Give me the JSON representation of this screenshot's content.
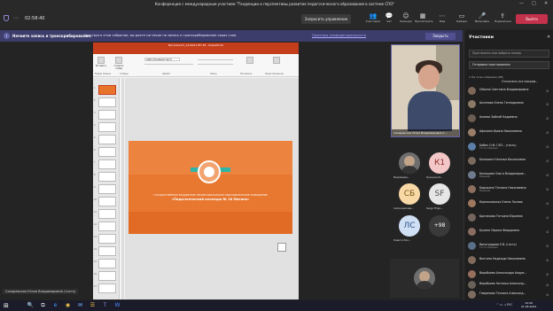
{
  "window": {
    "title": "Конференция с международным участием \"Тенденции и перспективы развития педагогического образования в системе СПО\"",
    "minimize": "—",
    "maximize": "□",
    "close": "✕"
  },
  "meeting": {
    "timer": "02:58:40",
    "more_dots": "⋯",
    "request_control": "Запросить управление",
    "tools": [
      {
        "label": "Участники",
        "icon": "people-icon",
        "glyph": "👥",
        "active": true
      },
      {
        "label": "Чат",
        "icon": "chat-icon",
        "glyph": "💬",
        "active": false
      },
      {
        "label": "Реакции",
        "icon": "reactions-icon",
        "glyph": "☺",
        "active": false
      },
      {
        "label": "Просмотреть",
        "icon": "view-icon",
        "glyph": "▦",
        "active": false
      },
      {
        "label": "Еще",
        "icon": "more-icon",
        "glyph": "⋯",
        "active": false
      },
      {
        "label": "Камера",
        "icon": "camera-icon",
        "glyph": "▭",
        "active": false
      },
      {
        "label": "Микрофон",
        "icon": "microphone-icon",
        "glyph": "🎤",
        "active": false
      },
      {
        "label": "Поделиться",
        "icon": "share-icon",
        "glyph": "⇪",
        "active": false
      }
    ],
    "leave": "Выйти"
  },
  "banner": {
    "title": "Начните запись и транскрибирование.",
    "text": "Участвуя в этом собрании, вы даете согласие на запись и транскрибирование своих слов.",
    "link": "Политика конфиденциальности",
    "close": "Закрыть"
  },
  "powerpoint": {
    "title": "Виталия 07_10.2021 ПП 18 - PowerPoint",
    "tabs": [
      "Файл",
      "Главная",
      "Вставка",
      "Дизайн",
      "Переходы",
      "Анимация",
      "Слайд-шоу",
      "Рецензи"
    ],
    "active_tab": "Главная",
    "ribbon": {
      "paste": "Вставить",
      "create_slide": "Создать слайд",
      "clipboard": "Буфер обмена",
      "slides": "Слайды",
      "font": "Шрифт",
      "paragraph": "Абзац",
      "drawing": "Рисование",
      "editing": "Редактирование",
      "font_name": "Calibri (Основной текст)"
    },
    "thumbnails": [
      "1",
      "2",
      "3",
      "4",
      "5",
      "6",
      "7",
      "8",
      "9",
      "10",
      "11",
      "12",
      "13",
      "14",
      "15",
      "16",
      "17",
      "18"
    ],
    "slide": {
      "subtitle": "ГОСУДАРСТВЕННОЕ БЮДЖЕТНОЕ ПРОФЕССИОНАЛЬНОЕ ОБРАЗОВАТЕЛЬНОЕ УЧРЕЖДЕНИЕ",
      "main": "«Педагогический колледж № 18 Митино»"
    }
  },
  "videos": {
    "main_name": "Сахаревская Юлия Владимировна (г...",
    "tiles": [
      {
        "name": "Воробьева...",
        "type": "photo"
      },
      {
        "name": "Кучинин И...",
        "initials": "К1",
        "color": "#f3c7c7"
      },
      {
        "name": "Сапожникова...",
        "initials": "СБ",
        "color": "#f8d9a6"
      },
      {
        "name": "Sergo Filipo...",
        "initials": "SF",
        "color": "#e6e6e6"
      },
      {
        "name": "Левитн Еле...",
        "initials": "ЛС",
        "color": "#cfe0f5"
      },
      {
        "name": "+98",
        "initials": "+98",
        "color": "#3a3a3a"
      }
    ],
    "self_label": "Сахаревская Юлия Владимировна (гость)"
  },
  "participants": {
    "title": "Участники",
    "close_glyph": "✕",
    "invite_placeholder": "Пригласить или набрать номер",
    "share_invite": "Отправка приглашения",
    "section": "∨ На этом собрании (98)",
    "mute_all": "Отключить все микроф...",
    "list": [
      {
        "name": "Ойкина Светлана Владимировна",
        "role": ""
      },
      {
        "name": "Аксенова Елена Геннадьевна",
        "role": ""
      },
      {
        "name": "Алиева Зайнаб Кадиевна",
        "role": ""
      },
      {
        "name": "Афонина Ирина Николаевна",
        "role": ""
      },
      {
        "name": "Бабич О.Ф. ГАП... (гость)",
        "role": "Гость собрания"
      },
      {
        "name": "Балакина Наталья Васильевна",
        "role": ""
      },
      {
        "name": "Балашова Ольга Владимиров...",
        "role": "Внешний"
      },
      {
        "name": "Барыкина Татьяна Николаевна",
        "role": "Внешний"
      },
      {
        "name": "Бережковская Елена Льнова",
        "role": ""
      },
      {
        "name": "Бритикова Татьяна Юрьевна",
        "role": ""
      },
      {
        "name": "Букина Лариса Федоровна",
        "role": ""
      },
      {
        "name": "Виноградова Е.В. (гость)",
        "role": "Гость собрания"
      },
      {
        "name": "Волгина Надежда Николаевна",
        "role": ""
      },
      {
        "name": "Воробьева Александра Андре...",
        "role": ""
      },
      {
        "name": "Воробьева Наталья Александ...",
        "role": ""
      },
      {
        "name": "Гаврилова Татьяна Александ...",
        "role": ""
      }
    ]
  },
  "taskbar": {
    "start_glyph": "⊞",
    "apps": [
      "🔍",
      "⧉",
      "e",
      "◉",
      "✉",
      "☰",
      "T",
      "W"
    ],
    "tray": "^ ▭ ◁ РУС",
    "time": "12:29",
    "date": "21.05.2022"
  },
  "colors": {
    "teams_purple": "#6264a7",
    "leave_red": "#c4314b",
    "ppt_orange": "#c43e1c",
    "slide_orange": "#e8772f"
  }
}
